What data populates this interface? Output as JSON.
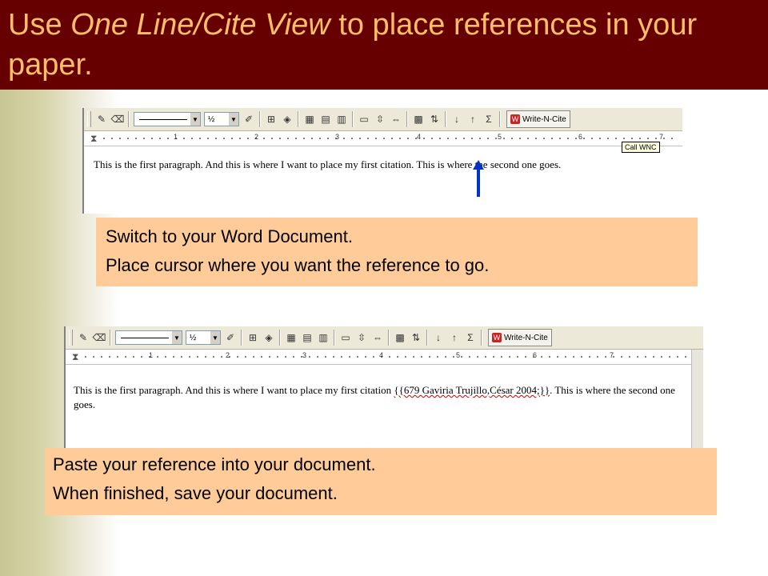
{
  "title": {
    "prefix": "Use ",
    "emphasis": "One Line/Cite View",
    "suffix": " to place references in your paper."
  },
  "colors": {
    "title_bg": "#660000",
    "title_text": "#ffbf66",
    "callout_bg": "#ffcc99",
    "arrow": "#0033cc"
  },
  "toolbar": {
    "line_weight": "½",
    "wnc_label": "Write-N-Cite",
    "tooltip": "Call WNC",
    "icons": [
      "pencil-icon",
      "eraser-icon",
      "line-style-select",
      "line-weight-select",
      "pen-color-icon",
      "borders-icon",
      "shading-color-icon",
      "insert-table-icon",
      "table-grid-icon",
      "merge-cells-icon",
      "align-icon",
      "distribute-rows-icon",
      "distribute-columns-icon",
      "table-autoformat-icon",
      "text-direction-icon",
      "sort-ascending-icon",
      "sort-descending-icon",
      "autosum-icon",
      "write-n-cite-button"
    ]
  },
  "ruler": {
    "numbers": [
      "1",
      "2",
      "3",
      "4",
      "5",
      "6",
      "7"
    ]
  },
  "step1": {
    "document_text": "This is the first paragraph.  And this is where I want to place my first citation. This is where the second one goes.",
    "callout_lines": [
      "Switch to your Word Document.",
      "Place cursor where you want the reference to go."
    ]
  },
  "step2": {
    "document_before": "This is the first paragraph. And this is where I want to place my first citation ",
    "citation": "{{679 Gaviria Trujillo,César 2004;}}",
    "document_after": ". This is where the second one goes.",
    "callout_lines": [
      "Paste your reference into your document.",
      "When finished, save your document."
    ]
  }
}
